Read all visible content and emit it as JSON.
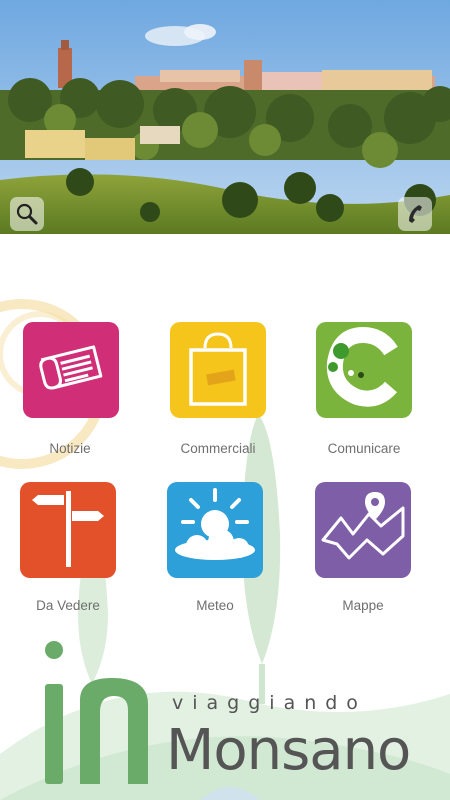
{
  "header": {
    "search_icon": "search-icon",
    "phone_icon": "phone-icon"
  },
  "tiles": [
    {
      "label": "Notizie",
      "color": "#d02e77",
      "icon": "newspaper-icon"
    },
    {
      "label": "Commerciali",
      "color": "#f5c51c",
      "icon": "shopping-bag-icon"
    },
    {
      "label": "Comunicare",
      "color": "#7ab43c",
      "icon": "chat-c-icon"
    },
    {
      "label": "Da Vedere",
      "color": "#e2512a",
      "icon": "signpost-icon"
    },
    {
      "label": "Meteo",
      "color": "#2d9fd9",
      "icon": "sun-cloud-icon"
    },
    {
      "label": "Mappe",
      "color": "#7d5ea7",
      "icon": "map-pin-icon"
    }
  ],
  "brand": {
    "prefix": "in",
    "tagline": "viaggiando",
    "name": "Monsano",
    "accent": "#6aab6a"
  }
}
